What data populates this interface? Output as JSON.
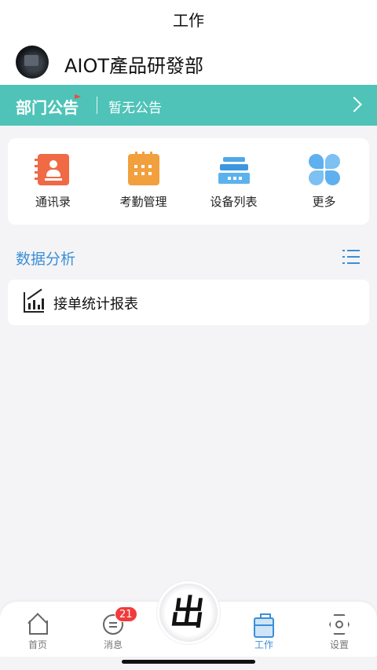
{
  "header": {
    "title": "工作",
    "org_name": "AIOT產品研發部"
  },
  "notice": {
    "label": "部门公告",
    "text": "暂无公告"
  },
  "grid": [
    {
      "label": "通讯录",
      "icon": "contacts-book-icon"
    },
    {
      "label": "考勤管理",
      "icon": "calendar-icon"
    },
    {
      "label": "设备列表",
      "icon": "device-stack-icon"
    },
    {
      "label": "更多",
      "icon": "four-petal-grid-icon"
    }
  ],
  "section": {
    "title": "数据分析"
  },
  "reports": [
    {
      "label": "接单统计报表",
      "icon": "line-chart-icon"
    }
  ],
  "tabbar": {
    "home": "首页",
    "messages": "消息",
    "messages_badge": "21",
    "work": "工作",
    "settings": "设置",
    "center_logo_text": "出"
  },
  "colors": {
    "accent": "#3a8fd8",
    "notice_bg": "#4fc3b8",
    "badge": "#f23b3b"
  }
}
